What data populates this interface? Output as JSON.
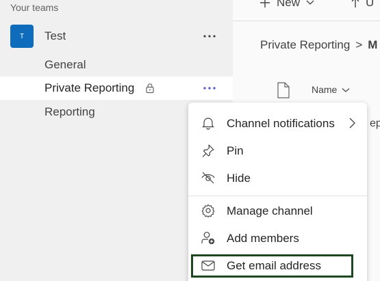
{
  "sidebar": {
    "section_title": "Your teams",
    "team": {
      "avatar_letter": "T",
      "name": "Test"
    },
    "channels": [
      {
        "label": "General"
      },
      {
        "label": "Private Reporting"
      },
      {
        "label": "Reporting"
      }
    ]
  },
  "toolbar": {
    "new_label": "New",
    "upload_label": "U"
  },
  "breadcrumb": {
    "parent": "Private Reporting",
    "separator": ">",
    "current": "M"
  },
  "files": {
    "name_column": "Name",
    "partial_row_text": "epo"
  },
  "menu": {
    "items": [
      {
        "label": "Channel notifications",
        "icon": "bell-icon"
      },
      {
        "label": "Pin",
        "icon": "pin-icon"
      },
      {
        "label": "Hide",
        "icon": "eye-off-icon"
      },
      {
        "label": "Manage channel",
        "icon": "gear-icon"
      },
      {
        "label": "Add members",
        "icon": "add-person-icon"
      },
      {
        "label": "Get email address",
        "icon": "mail-icon"
      }
    ],
    "highlight_color": "#1e4620"
  },
  "colors": {
    "accent": "#5b5fc7",
    "avatar": "#0f6cbd"
  }
}
